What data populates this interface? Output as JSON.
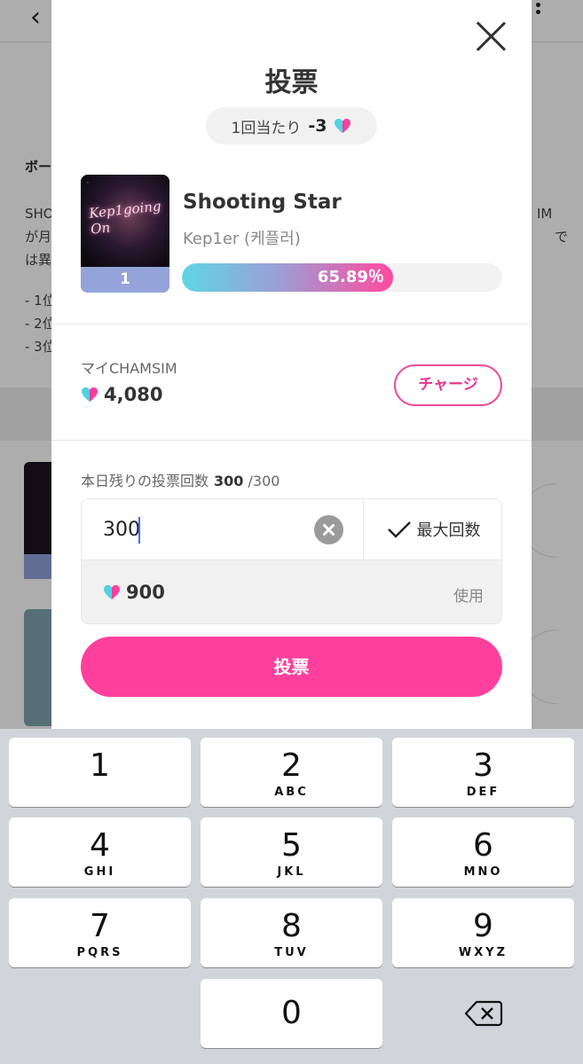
{
  "background": {
    "section_title": "ボー",
    "desc_lines": [
      "SHO",
      "が月",
      "は異"
    ],
    "desc_right": [
      "IM",
      "で"
    ],
    "rank_lines": [
      "- 1位",
      "- 2位",
      "- 3位"
    ]
  },
  "modal": {
    "title": "投票",
    "cost_label": "1回当たり",
    "cost_value": "-3",
    "song": {
      "album_text": "Kep1going On",
      "rank": "1",
      "title": "Shooting Star",
      "artist": "Kep1er (케플러)",
      "progress_label": "65.89％",
      "progress_fraction": 0.6589
    },
    "my_chamsim_label": "マイCHAMSIM",
    "my_chamsim_value": "4,080",
    "charge_button": "チャージ",
    "remaining_label": "本日残りの投票回数",
    "remaining_value": "300",
    "remaining_total": "/300",
    "vote_input_value": "300",
    "max_button": "最大回数",
    "use_amount": "900",
    "use_label": "使用",
    "vote_button": "投票"
  },
  "colors": {
    "accent_pink": "#ff3f9c",
    "charge_border": "#ee4c9c",
    "rank_badge": "#94a3d9",
    "heart_cyan": "#4fd3e0",
    "heart_pink": "#ff3f9c"
  },
  "keyboard": {
    "keys": [
      {
        "num": "1",
        "letters": ""
      },
      {
        "num": "2",
        "letters": "ABC"
      },
      {
        "num": "3",
        "letters": "DEF"
      },
      {
        "num": "4",
        "letters": "GHI"
      },
      {
        "num": "5",
        "letters": "JKL"
      },
      {
        "num": "6",
        "letters": "MNO"
      },
      {
        "num": "7",
        "letters": "PQRS"
      },
      {
        "num": "8",
        "letters": "TUV"
      },
      {
        "num": "9",
        "letters": "WXYZ"
      },
      {
        "num": "0",
        "letters": ""
      }
    ],
    "delete_icon": "backspace-icon"
  }
}
